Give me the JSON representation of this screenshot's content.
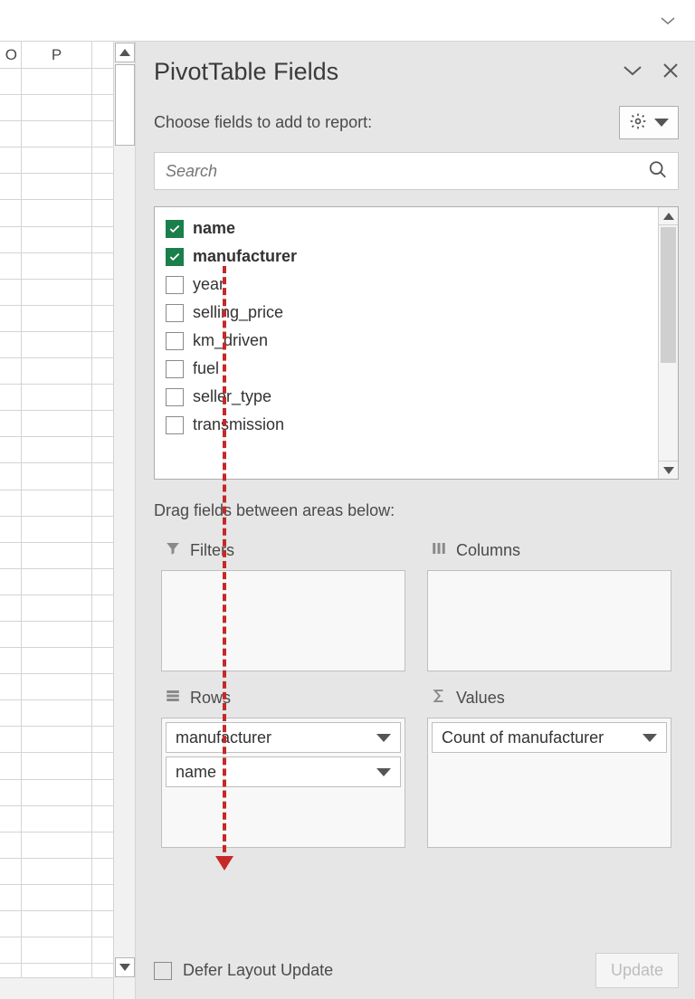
{
  "columns": {
    "o": "O",
    "p": "P"
  },
  "pane": {
    "title": "PivotTable Fields",
    "subtitle": "Choose fields to add to report:",
    "search_placeholder": "Search",
    "drag_label": "Drag fields between areas below:",
    "fields": [
      {
        "label": "name",
        "checked": true
      },
      {
        "label": "manufacturer",
        "checked": true
      },
      {
        "label": "year",
        "checked": false
      },
      {
        "label": "selling_price",
        "checked": false
      },
      {
        "label": "km_driven",
        "checked": false
      },
      {
        "label": "fuel",
        "checked": false
      },
      {
        "label": "seller_type",
        "checked": false
      },
      {
        "label": "transmission",
        "checked": false
      }
    ],
    "areas": {
      "filters_label": "Filters",
      "columns_label": "Columns",
      "rows_label": "Rows",
      "values_label": "Values",
      "rows": [
        "manufacturer",
        "name"
      ],
      "values": [
        "Count of manufacturer"
      ]
    },
    "defer_label": "Defer Layout Update",
    "update_label": "Update"
  }
}
